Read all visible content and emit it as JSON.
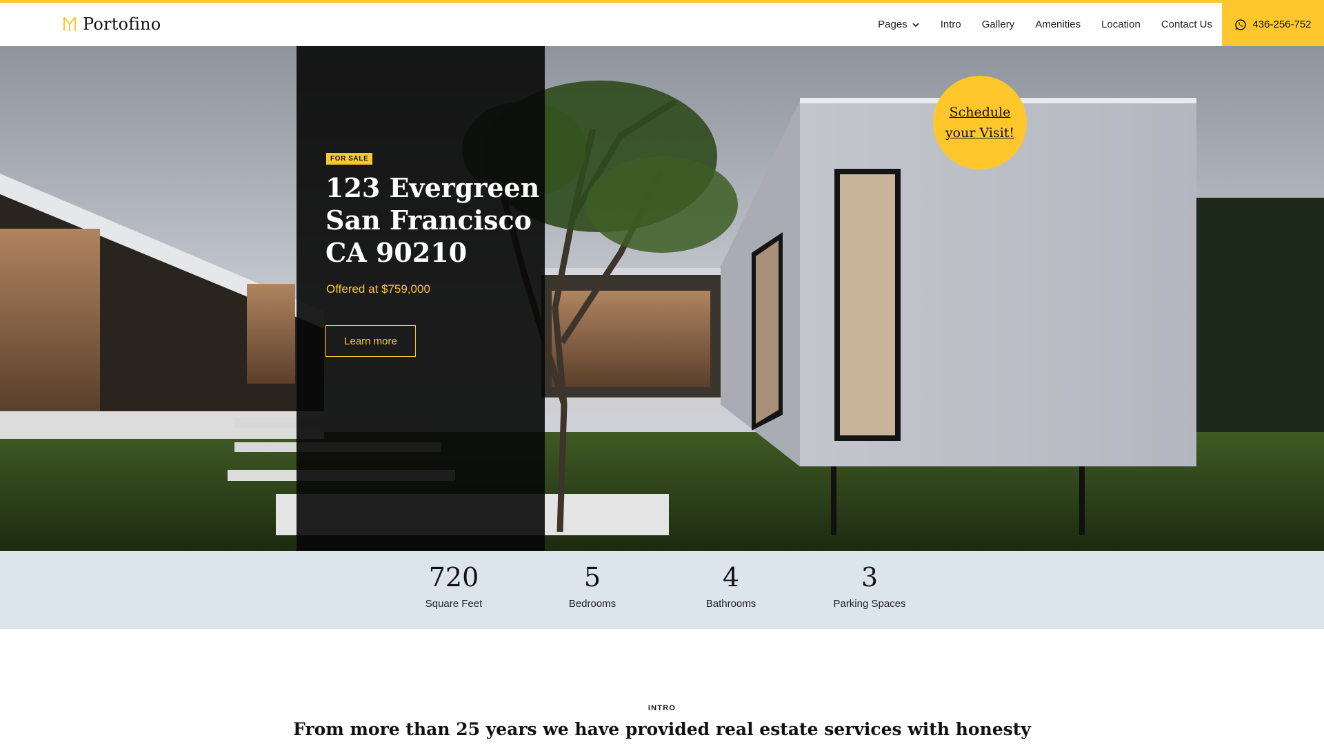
{
  "brand": {
    "name": "Portofino",
    "accent_color": "#FFC72C"
  },
  "nav": {
    "items": [
      {
        "label": "Pages",
        "icon": "chevron-down-icon"
      },
      {
        "label": "Intro"
      },
      {
        "label": "Gallery"
      },
      {
        "label": "Amenities"
      },
      {
        "label": "Location"
      },
      {
        "label": "Contact Us"
      }
    ],
    "phone": {
      "label": "436-256-752",
      "icon": "whatsapp-icon"
    }
  },
  "hero": {
    "badge": "FOR SALE",
    "title_lines": [
      "123 Evergreen",
      "San Francisco",
      "CA 90210"
    ],
    "price": "Offered at $759,000",
    "cta_label": "Learn more",
    "schedule_lines": [
      "Schedule",
      "your Visit!"
    ]
  },
  "stats": [
    {
      "value": "720",
      "label": "Square Feet"
    },
    {
      "value": "5",
      "label": "Bedrooms"
    },
    {
      "value": "4",
      "label": "Bathrooms"
    },
    {
      "value": "3",
      "label": "Parking Spaces"
    }
  ],
  "intro": {
    "eyebrow": "INTRO",
    "heading": "From more than 25 years we have provided real estate services with honesty"
  }
}
